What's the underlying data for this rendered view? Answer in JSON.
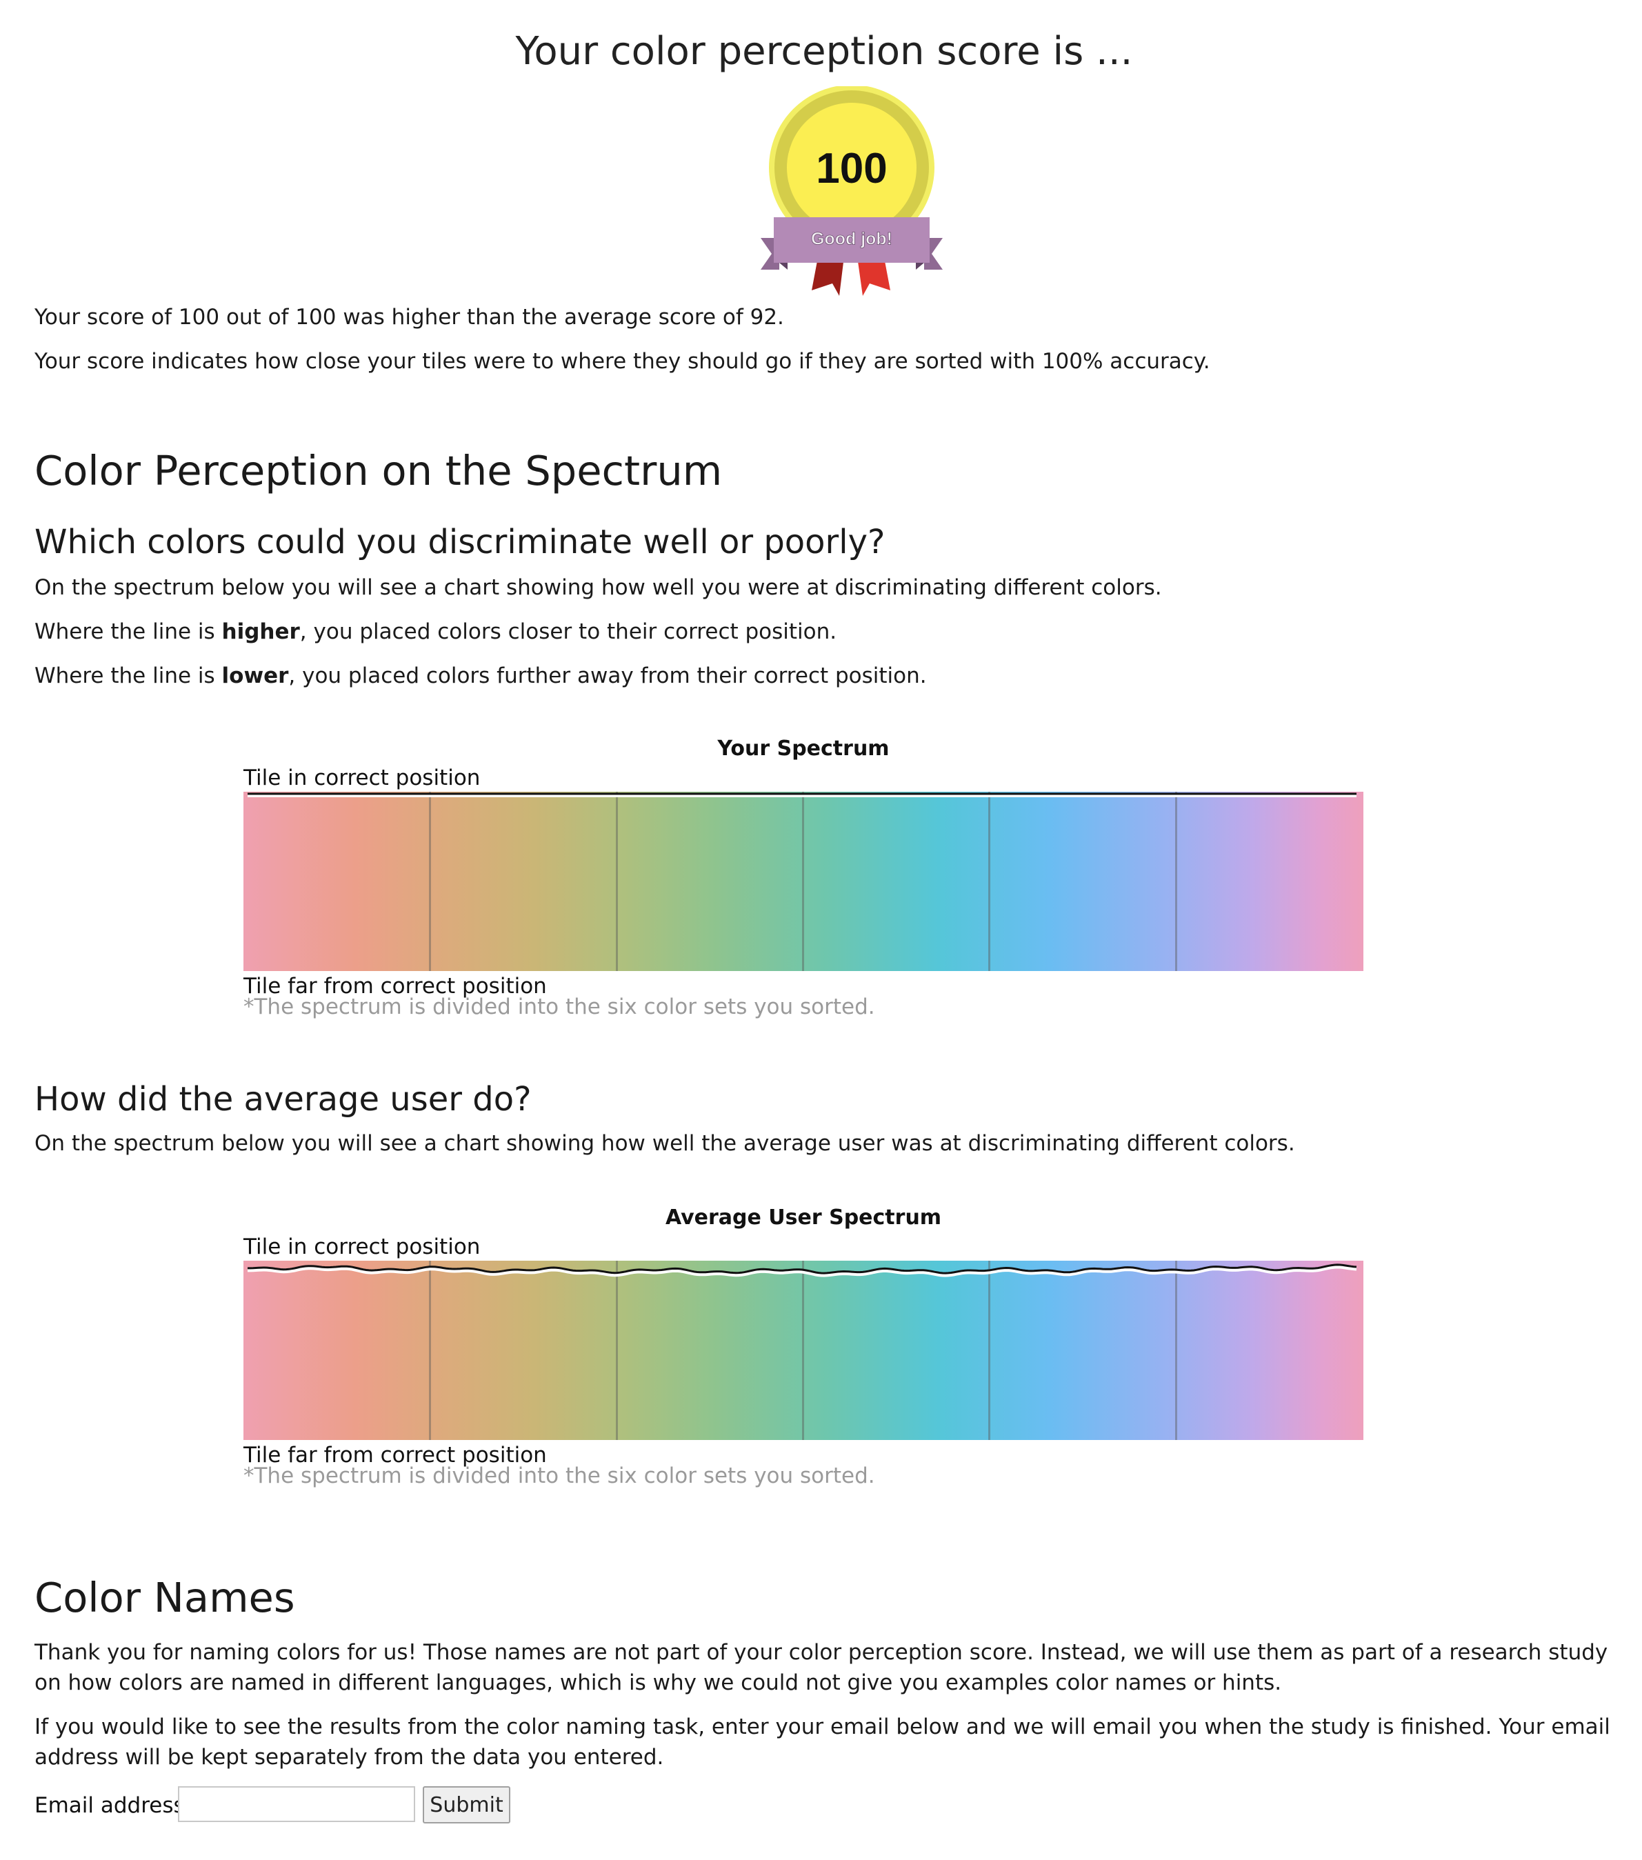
{
  "header": {
    "title": "Your color perception score is ..."
  },
  "badge": {
    "score": "100",
    "ribbon_text": "Good job!"
  },
  "summary": {
    "score_text": "Your score of 100 out of 100 was higher than the average score of 92.",
    "explanation": "Your score indicates how close your tiles were to where they should go if they are sorted with 100% accuracy."
  },
  "perception": {
    "heading": "Color Perception on the Spectrum",
    "subheading": "Which colors could you discriminate well or poorly?",
    "intro": "On the spectrum below you will see a chart showing how well you were at discriminating different colors.",
    "higher_pre": "Where the line is ",
    "higher_bold": "higher",
    "higher_post": ", you placed colors closer to their correct position.",
    "lower_pre": "Where the line is ",
    "lower_bold": "lower",
    "lower_post": ", you placed colors further away from their correct position."
  },
  "your_spectrum": {
    "title": "Your Spectrum",
    "top_label": "Tile in correct position",
    "bottom_label": "Tile far from correct position",
    "note": "*The spectrum is divided into the six color sets you sorted."
  },
  "average": {
    "heading": "How did the average user do?",
    "intro": "On the spectrum below you will see a chart showing how well the average user was at discriminating different colors."
  },
  "average_spectrum": {
    "title": "Average User Spectrum",
    "top_label": "Tile in correct position",
    "bottom_label": "Tile far from correct position",
    "note": "*The spectrum is divided into the six color sets you sorted."
  },
  "names": {
    "heading": "Color Names",
    "para1": "Thank you for naming colors for us! Those names are not part of your color perception score. Instead, we will use them as part of a research study on how colors are named in different languages, which is why we could not give you examples color names or hints.",
    "para2": "If you would like to see the results from the color naming task, enter your email below and we will email you when the study is finished. Your email address will be kept separately from the data you entered.",
    "email_label": "Email address:",
    "email_value": "",
    "submit_label": "Submit"
  },
  "colors": {
    "badge_outer": "#f2ee64",
    "badge_ring": "#d4cd4a",
    "badge_inner": "#fbee52",
    "ribbon": "#b38ab6",
    "ribbon_tail": "#8f6a93",
    "ribbon_red": "#e0352c",
    "ribbon_dark_red": "#9c1e18"
  }
}
